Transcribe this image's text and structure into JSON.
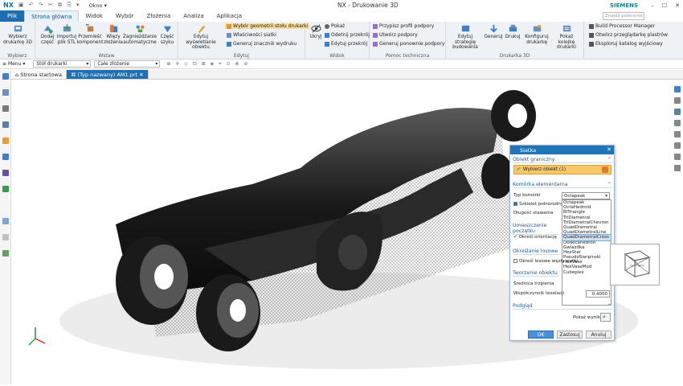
{
  "titlebar": {
    "app": "NX",
    "window_menu": "Okno",
    "title": "NX - Drukowanie 3D",
    "brand": "SIEMENS"
  },
  "tabs": [
    "Plik",
    "Strona główna",
    "Widok",
    "Wybór",
    "Złożenia",
    "Analiza",
    "Aplikacja"
  ],
  "search_placeholder": "Znajdź polecenie",
  "ribbon": {
    "wybierz": {
      "btn": "Wybierz drukarkę 3D",
      "label": "Wybierz"
    },
    "wstaw": {
      "buttons": [
        "Dodaj część",
        "Importuj plik STL",
        "Przemieść komponent",
        "Więzy złożenia",
        "Zagnieżdżanie automatyczne",
        "Część szyku"
      ],
      "label": "Wstaw"
    },
    "edytuj": {
      "btn": "Edytuj wyświetlanie obiektu",
      "items": [
        "Wybór geometrii stołu drukarki",
        "Właściwości siatki",
        "Generuj znacznik wydruku"
      ],
      "label": "Edytuj"
    },
    "widok": {
      "btn": "Ukryj",
      "items": [
        "Pokaż",
        "Odetnij przekrój",
        "Edytuj przekrój"
      ],
      "label": "Widok"
    },
    "pomoc": {
      "items": [
        "Przypisz profil podpory",
        "Utwórz podpory",
        "Generuj ponownie podpory"
      ],
      "label": "Pomoc techniczna"
    },
    "druk": {
      "buttons": [
        "Edytuj strategię budowania",
        "Generuj",
        "Drukuj",
        "Konfiguruj drukarkę",
        "Pokaż kolejkę drukarki"
      ],
      "label": "Drukarka 3D"
    },
    "extra": [
      "Build Processor Manager",
      "Otwórz przeglądarkę plastrów",
      "Eksploruj katalog wyjściowy"
    ]
  },
  "toolbar2": {
    "menu": "Menu",
    "filter": "Stół drukarki",
    "scope": "Całe złożenie"
  },
  "doctabs": [
    "Strona startowa",
    "(Typ nazwany) AM1.prt"
  ],
  "dialog": {
    "title": "Siatka",
    "sec1": "Obiekt graniczny",
    "select": "Wybierz obiekt (1)",
    "sec2": "Komórka elementarna",
    "type_label": "Typ komórki",
    "type_value": "Octapeak",
    "uniform": "Szkielet jednorodny",
    "size_label": "Długość stawania",
    "options": [
      "Octapeak",
      "OctaHedroid",
      "BiTriangle",
      "TriDiametral",
      "TriDiametralChevron",
      "QuadDiametral",
      "QuadDiametralLine",
      "QuadDiametralCross",
      "Dodecahedron",
      "Gwiazdka",
      "HexStar",
      "PseudoSierpinski",
      "HexVase",
      "HexVaseMod",
      "Cubeplex"
    ],
    "selected_option": "QuadDiametralCross",
    "sec3": "Umieszczenie początku",
    "orient": "Określ orientację",
    "sec4": "Określanie losowe",
    "random": "Określ losowe węzły siatki",
    "sec5": "Tworzenie obiektu",
    "diameter": "Średnica trzpienia",
    "tess": "Współczynnik teselacji",
    "tess_value": "0.4000",
    "sec6": "Podgląd",
    "show": "Pokaż wynik",
    "ok": "OK",
    "apply": "Zastosuj",
    "cancel": "Anuluj"
  },
  "colors": {
    "accent": "#1f75b7",
    "file_tab": "#1b6fb0",
    "selection": "#f7c86a"
  }
}
